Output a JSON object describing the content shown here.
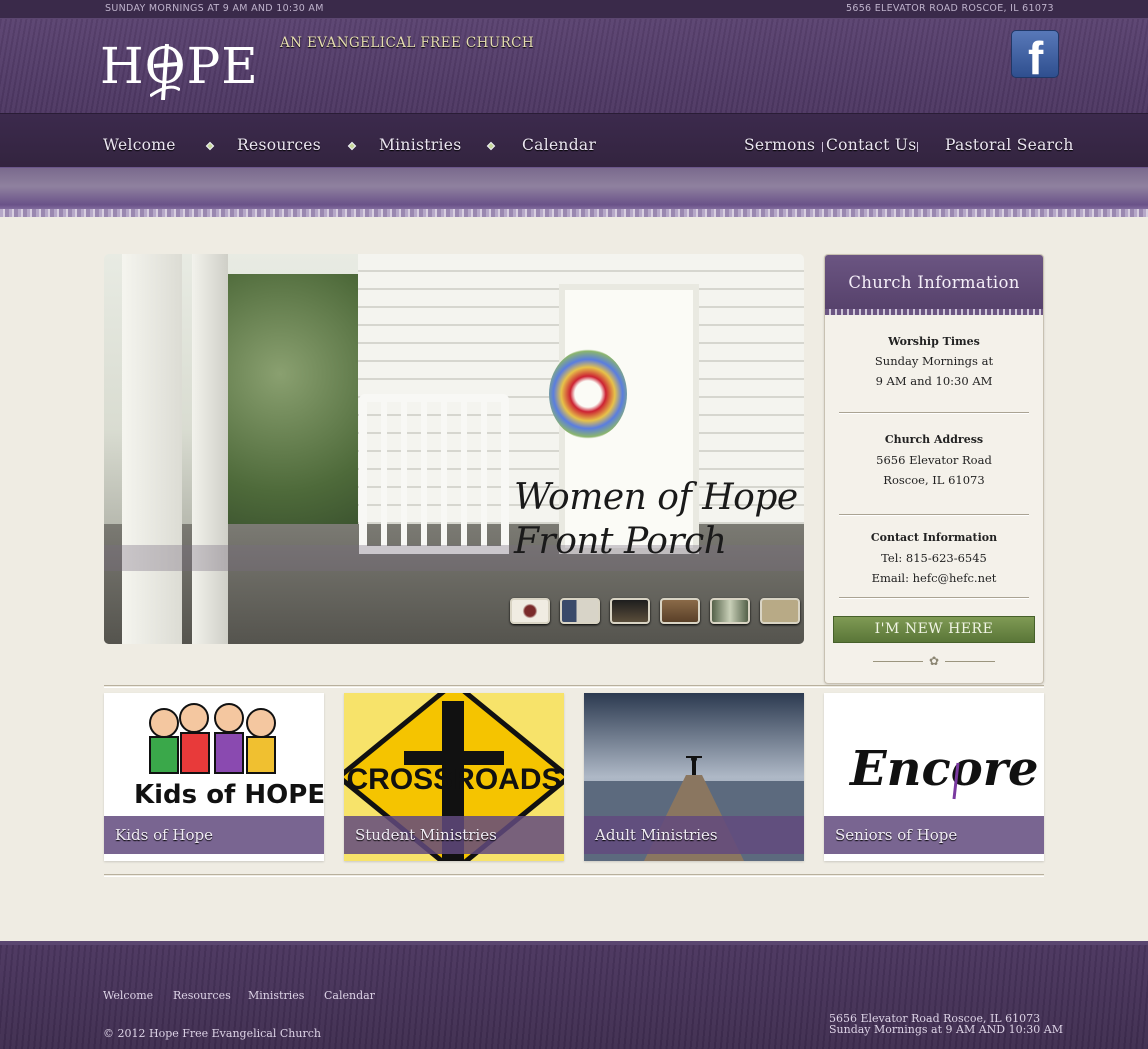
{
  "topbar": {
    "left": "SUNDAY MORNINGS AT 9 AM AND 10:30 AM",
    "right": "5656 ELEVATOR ROAD ROSCOE, IL 61073"
  },
  "header": {
    "logo_text": "HOPE",
    "tagline": "AN EVANGELICAL FREE CHURCH",
    "facebook_icon": "facebook-icon",
    "facebook_letter": "f"
  },
  "nav": {
    "items": [
      "Welcome",
      "Resources",
      "Ministries",
      "Calendar"
    ],
    "right_items": [
      "Sermons",
      "Contact Us",
      "Pastoral Search"
    ]
  },
  "slider": {
    "caption": "Women of Hope\nFront Porch",
    "thumb_count": 6
  },
  "info": {
    "title": "Church Information",
    "worship_heading": "Worship Times",
    "worship_line1": "Sunday Mornings at",
    "worship_line2": "9 AM and 10:30 AM",
    "address_heading": "Church Address",
    "address_line1": "5656 Elevator Road",
    "address_line2": "Roscoe, IL 61073",
    "contact_heading": "Contact Information",
    "contact_tel": "Tel: 815-623-6545",
    "contact_email": "Email: hefc@hefc.net",
    "new_button": "I'M NEW HERE"
  },
  "ministries": [
    {
      "label": "Kids of Hope",
      "art": "Kids of HOPE"
    },
    {
      "label": "Student Ministries",
      "art": "CROSSROADS"
    },
    {
      "label": "Adult Ministries",
      "art": ""
    },
    {
      "label": "Seniors of Hope",
      "art": "Encore"
    }
  ],
  "footer": {
    "links": [
      "Welcome",
      "Resources",
      "Ministries",
      "Calendar"
    ],
    "copyright": "© 2012 Hope Free Evangelical Church",
    "address": "5656 Elevator Road Roscoe, IL 61073",
    "times": "Sunday Mornings at 9 AM AND 10:30 AM"
  }
}
